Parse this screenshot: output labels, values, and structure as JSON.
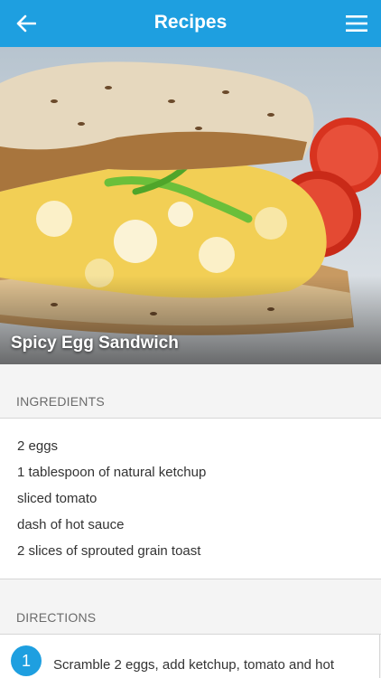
{
  "header": {
    "title": "Recipes",
    "back_icon": "arrow-left-icon",
    "menu_icon": "hamburger-menu-icon",
    "color": "#1e9fe0"
  },
  "recipe": {
    "name": "Spicy Egg Sandwich"
  },
  "ingredients": {
    "heading": "INGREDIENTS",
    "items": [
      "2 eggs",
      "1 tablespoon of natural ketchup",
      "sliced tomato",
      "dash of hot sauce",
      "2 slices of sprouted grain toast"
    ]
  },
  "directions": {
    "heading": "DIRECTIONS",
    "steps": [
      {
        "number": "1",
        "text": "Scramble 2 eggs, add ketchup, tomato and hot"
      }
    ]
  }
}
